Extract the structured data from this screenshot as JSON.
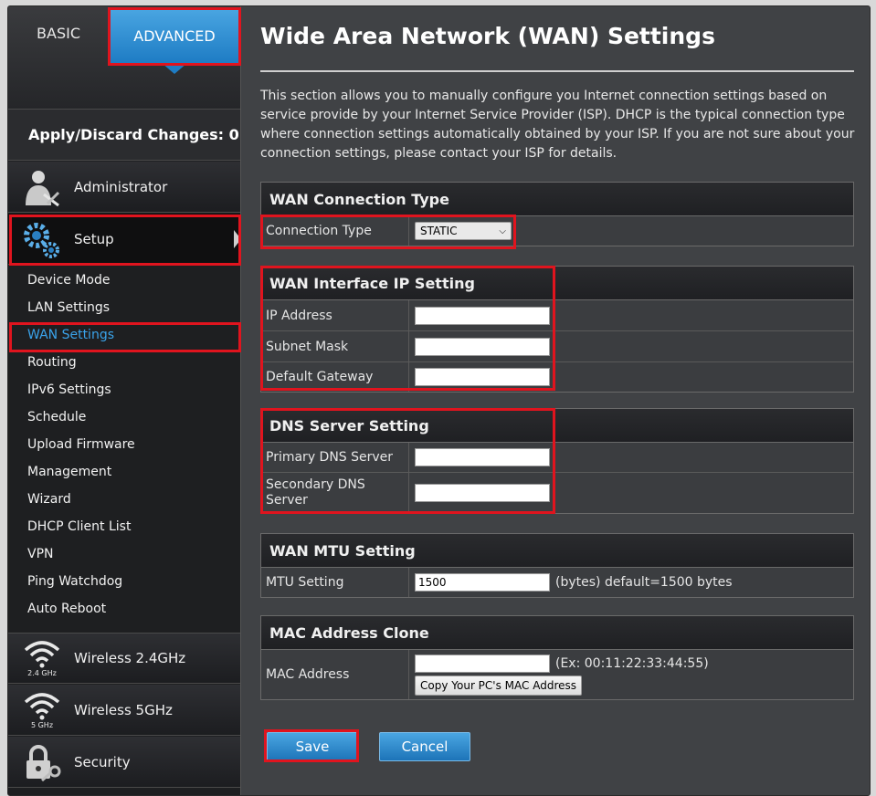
{
  "tabs": {
    "basic": "BASIC",
    "advanced": "ADVANCED"
  },
  "apply_label": "Apply/Discard Changes: 0",
  "sections": {
    "administrator": "Administrator",
    "setup": "Setup",
    "wireless24": "Wireless 2.4GHz",
    "wireless24_badge": "2.4 GHz",
    "wireless5": "Wireless 5GHz",
    "wireless5_badge": "5 GHz",
    "security": "Security"
  },
  "setup_items": [
    "Device Mode",
    "LAN Settings",
    "WAN Settings",
    "Routing",
    "IPv6 Settings",
    "Schedule",
    "Upload Firmware",
    "Management",
    "Wizard",
    "DHCP Client List",
    "VPN",
    "Ping Watchdog",
    "Auto Reboot"
  ],
  "main": {
    "title": "Wide Area Network (WAN) Settings",
    "intro": "This section allows you to manually configure you Internet connection settings based on service provide by your Internet Service Provider (ISP). DHCP is the typical connection type where connection settings automatically obtained by your ISP. If you are not sure about your connection settings, please contact your ISP for details."
  },
  "wan_type": {
    "heading": "WAN Connection Type",
    "label": "Connection Type",
    "selected": "STATIC"
  },
  "wan_ip": {
    "heading": "WAN Interface IP Setting",
    "ip_label": "IP Address",
    "mask_label": "Subnet Mask",
    "gw_label": "Default Gateway",
    "ip_value": "",
    "mask_value": "",
    "gw_value": ""
  },
  "dns": {
    "heading": "DNS Server Setting",
    "primary_label": "Primary DNS Server",
    "secondary_label": "Secondary DNS Server",
    "primary_value": "",
    "secondary_value": ""
  },
  "mtu": {
    "heading": "WAN MTU Setting",
    "label": "MTU Setting",
    "value": "1500",
    "hint": "(bytes) default=1500 bytes"
  },
  "mac": {
    "heading": "MAC Address Clone",
    "label": "MAC Address",
    "value": "",
    "hint": "(Ex: 00:11:22:33:44:55)",
    "copy_button": "Copy Your PC's MAC Address"
  },
  "buttons": {
    "save": "Save",
    "cancel": "Cancel"
  },
  "colors": {
    "accent": "#1e7cc4",
    "highlight": "#e0141e",
    "active_item": "#3aa3ea"
  }
}
